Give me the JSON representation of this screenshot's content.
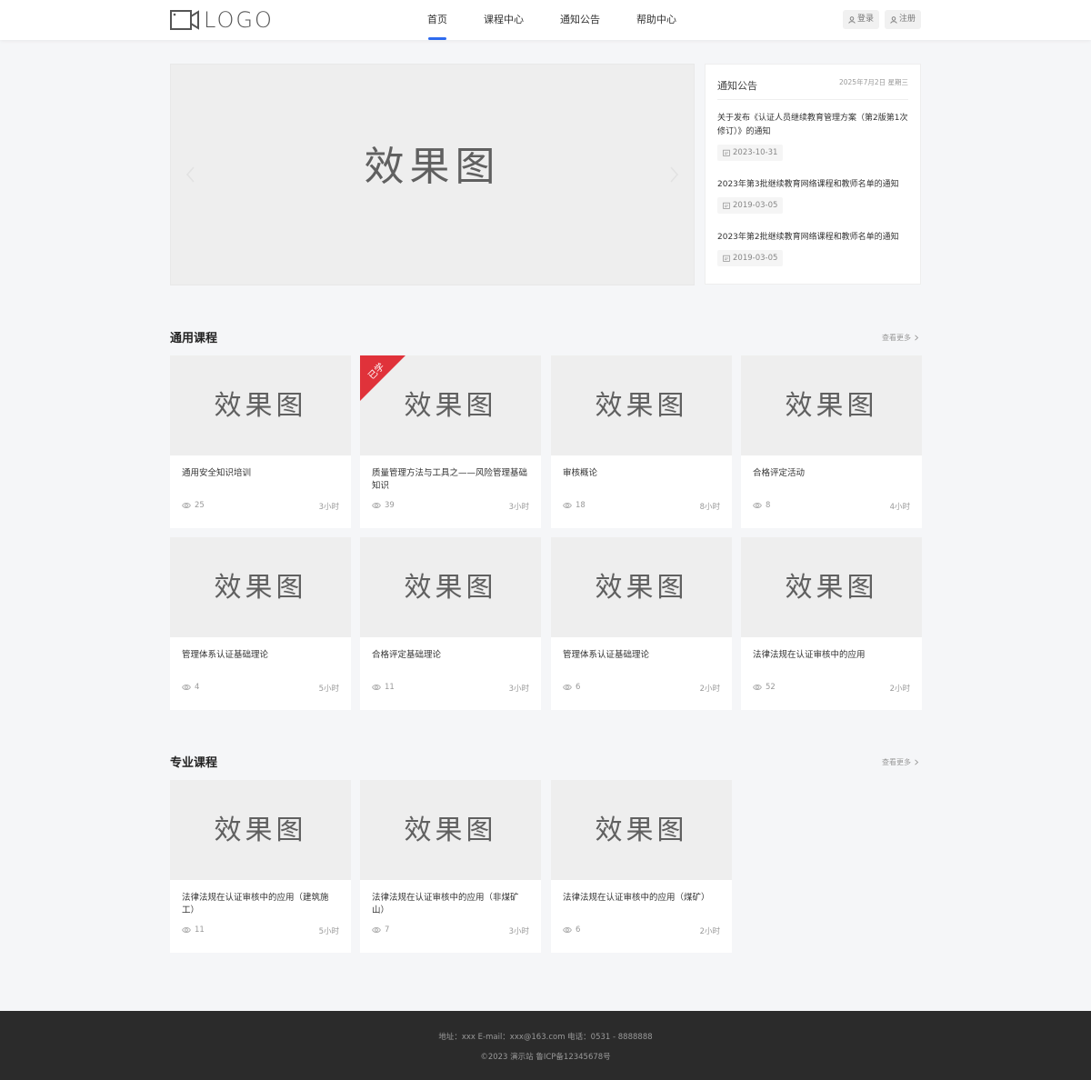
{
  "header": {
    "logo_text": "LOGO",
    "nav": [
      "首页",
      "课程中心",
      "通知公告",
      "帮助中心"
    ],
    "active_nav": "首页",
    "login_label": "登录",
    "register_label": "注册",
    "accent_color": "#2e6bef"
  },
  "banner": {
    "placeholder": "效果图",
    "prev_icon": "chevron-left-icon",
    "next_icon": "chevron-right-icon"
  },
  "notice": {
    "title": "通知公告",
    "date": "2025年7月2日 星期三",
    "items": [
      {
        "title": "关于发布《认证人员继续教育管理方案（第2版第1次修订）》的通知",
        "date": "2023-10-31"
      },
      {
        "title": "2023年第3批继续教育网络课程和教师名单的通知",
        "date": "2019-03-05"
      },
      {
        "title": "2023年第2批继续教育网络课程和教师名单的通知",
        "date": "2019-03-05"
      }
    ]
  },
  "sections": {
    "general": {
      "title": "通用课程",
      "more": "查看更多",
      "cards": [
        {
          "placeholder": "效果图",
          "title": "通用安全知识培训",
          "views": "25",
          "hours": "3小时"
        },
        {
          "placeholder": "效果图",
          "title": "质量管理方法与工具之——风险管理基础知识",
          "views": "39",
          "hours": "3小时",
          "badge": "已学"
        },
        {
          "placeholder": "效果图",
          "title": "审核概论",
          "views": "18",
          "hours": "8小时"
        },
        {
          "placeholder": "效果图",
          "title": "合格评定活动",
          "views": "8",
          "hours": "4小时"
        },
        {
          "placeholder": "效果图",
          "title": "管理体系认证基础理论",
          "views": "4",
          "hours": "5小时"
        },
        {
          "placeholder": "效果图",
          "title": "合格评定基础理论",
          "views": "11",
          "hours": "3小时"
        },
        {
          "placeholder": "效果图",
          "title": "管理体系认证基础理论",
          "views": "6",
          "hours": "2小时"
        },
        {
          "placeholder": "效果图",
          "title": "法律法规在认证审核中的应用",
          "views": "52",
          "hours": "2小时"
        }
      ]
    },
    "professional": {
      "title": "专业课程",
      "more": "查看更多",
      "cards": [
        {
          "placeholder": "效果图",
          "title": "法律法规在认证审核中的应用（建筑施工）",
          "views": "11",
          "hours": "5小时"
        },
        {
          "placeholder": "效果图",
          "title": "法律法规在认证审核中的应用（非煤矿山）",
          "views": "7",
          "hours": "3小时"
        },
        {
          "placeholder": "效果图",
          "title": "法律法规在认证审核中的应用（煤矿）",
          "views": "6",
          "hours": "2小时"
        }
      ]
    }
  },
  "footer": {
    "line1": "地址：xxx  E-mail：xxx@163.com   电话：0531 - 8888888",
    "line2": "©2023 演示站   鲁ICP备12345678号"
  }
}
